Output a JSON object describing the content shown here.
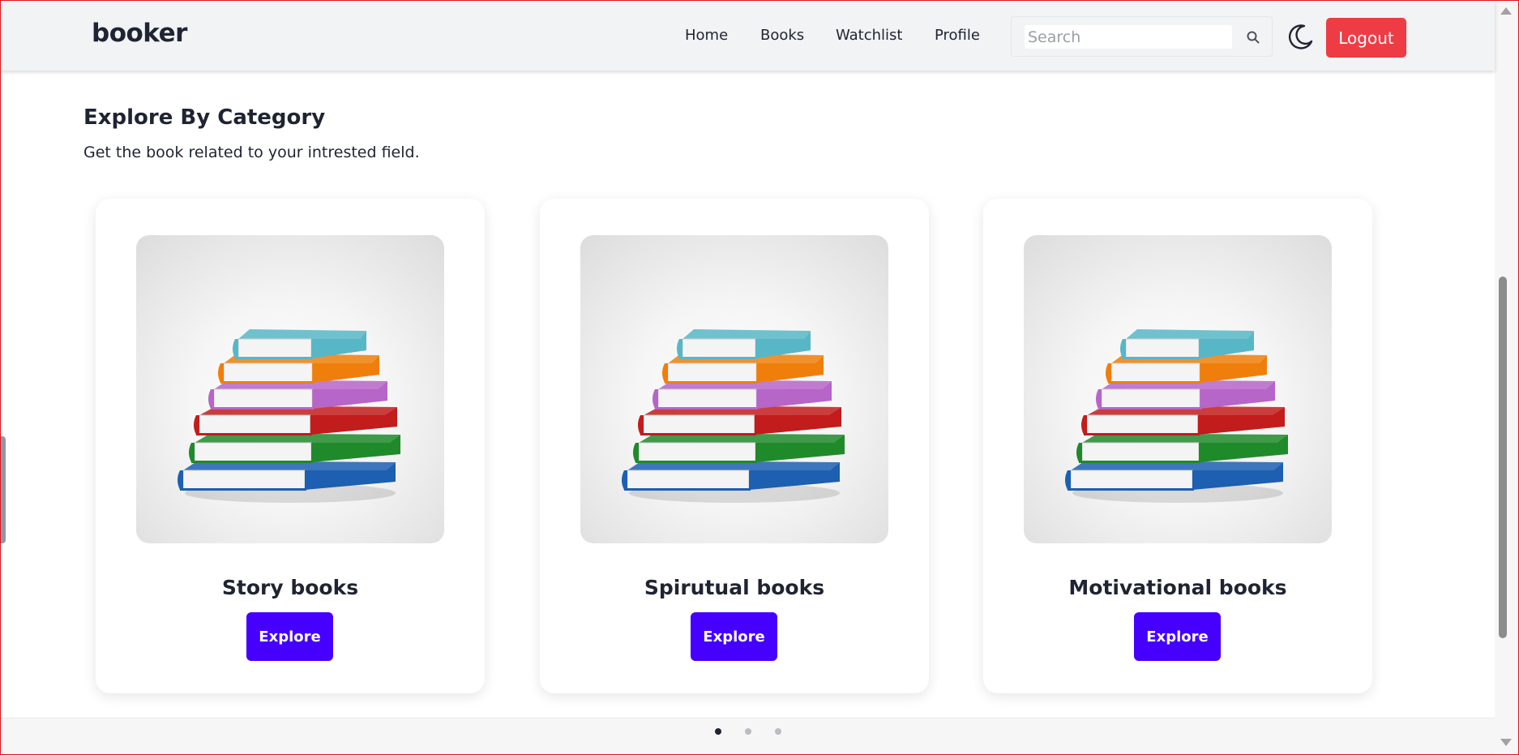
{
  "navbar": {
    "brand": "booker",
    "links": [
      "Home",
      "Books",
      "Watchlist",
      "Profile"
    ],
    "search_placeholder": "Search",
    "logout_label": "Logout",
    "theme_icon": "moon-icon"
  },
  "section": {
    "title": "Explore By Category",
    "subtitle": "Get the book related to your intrested field."
  },
  "cards": [
    {
      "title": "Story books",
      "button": "Explore",
      "image": "book-stack"
    },
    {
      "title": "Spirutual books",
      "button": "Explore",
      "image": "book-stack"
    },
    {
      "title": "Motivational books",
      "button": "Explore",
      "image": "book-stack"
    }
  ],
  "pagination": {
    "active_index": 0,
    "count": 3
  },
  "colors": {
    "accent": "#4500ff",
    "logout": "#ee3c45",
    "dot_active": "#1f2433",
    "dot_inactive": "#b9bcc1"
  }
}
